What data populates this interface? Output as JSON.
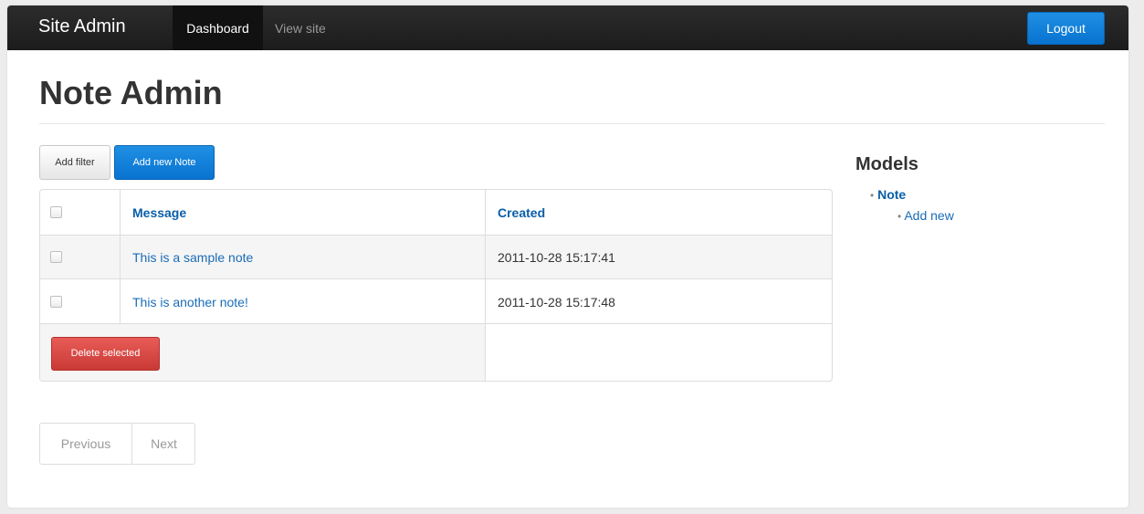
{
  "navbar": {
    "brand": "Site Admin",
    "items": [
      {
        "label": "Dashboard",
        "active": true
      },
      {
        "label": "View site",
        "active": false
      }
    ],
    "logout_label": "Logout"
  },
  "page": {
    "title": "Note Admin"
  },
  "toolbar": {
    "add_filter_label": "Add filter",
    "add_new_label": "Add new Note"
  },
  "table": {
    "columns": [
      "Message",
      "Created"
    ],
    "rows": [
      {
        "message": "This is a sample note",
        "created": "2011-10-28 15:17:41"
      },
      {
        "message": "This is another note!",
        "created": "2011-10-28 15:17:48"
      }
    ],
    "delete_label": "Delete selected"
  },
  "pagination": {
    "previous_label": "Previous",
    "next_label": "Next"
  },
  "sidebar": {
    "title": "Models",
    "items": [
      {
        "label": "Note",
        "children": [
          {
            "label": "Add new"
          }
        ]
      }
    ]
  },
  "colors": {
    "navbar_bg": "#1c1c1c",
    "primary": "#0873d0",
    "danger": "#c93a36",
    "link": "#1a6cb7"
  }
}
